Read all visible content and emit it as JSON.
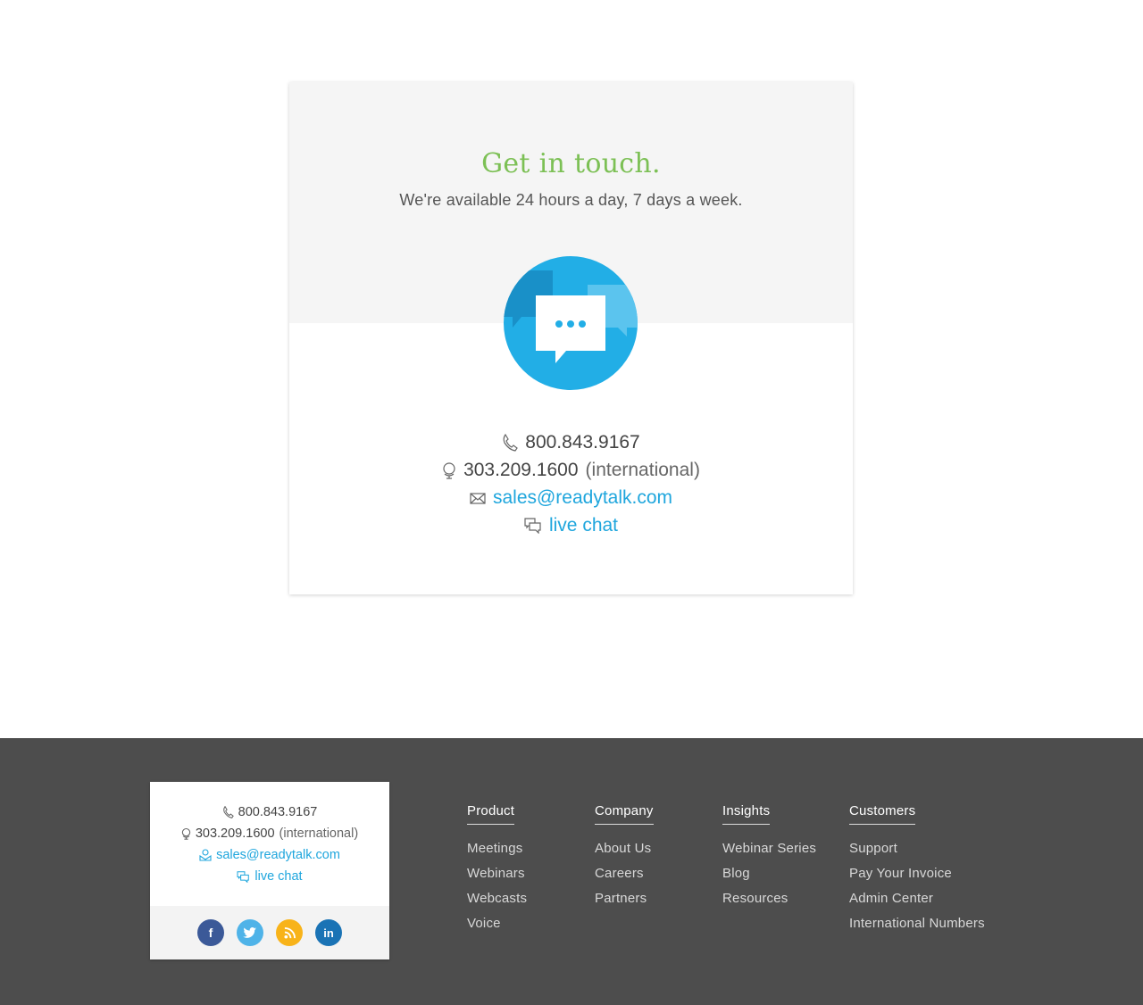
{
  "contact": {
    "title": "Get in touch.",
    "subtitle": "We're available 24 hours a day, 7 days a week.",
    "phone": "800.843.9167",
    "intl_phone": "303.209.1600",
    "intl_label": "(international)",
    "email": "sales@readytalk.com",
    "chat": "live chat"
  },
  "footer": {
    "mini": {
      "phone": "800.843.9167",
      "intl_phone": "303.209.1600",
      "intl_label": "(international)",
      "email": "sales@readytalk.com",
      "chat": "live chat"
    },
    "social": {
      "facebook": "f",
      "linkedin": "in"
    },
    "columns": [
      {
        "heading": "Product",
        "links": [
          "Meetings",
          "Webinars",
          "Webcasts",
          "Voice"
        ]
      },
      {
        "heading": "Company",
        "links": [
          "About Us",
          "Careers",
          "Partners"
        ]
      },
      {
        "heading": "Insights",
        "links": [
          "Webinar Series",
          "Blog",
          "Resources"
        ]
      },
      {
        "heading": "Customers",
        "links": [
          "Support",
          "Pay Your Invoice",
          "Admin Center",
          "International Numbers"
        ]
      }
    ]
  },
  "colors": {
    "accent_green": "#7cc055",
    "link_blue": "#1fa6dd",
    "footer_bg": "#4d4d4d",
    "facebook": "#3b5998",
    "twitter": "#4fb3e8",
    "rss": "#f8b319",
    "linkedin": "#1a73b5"
  }
}
